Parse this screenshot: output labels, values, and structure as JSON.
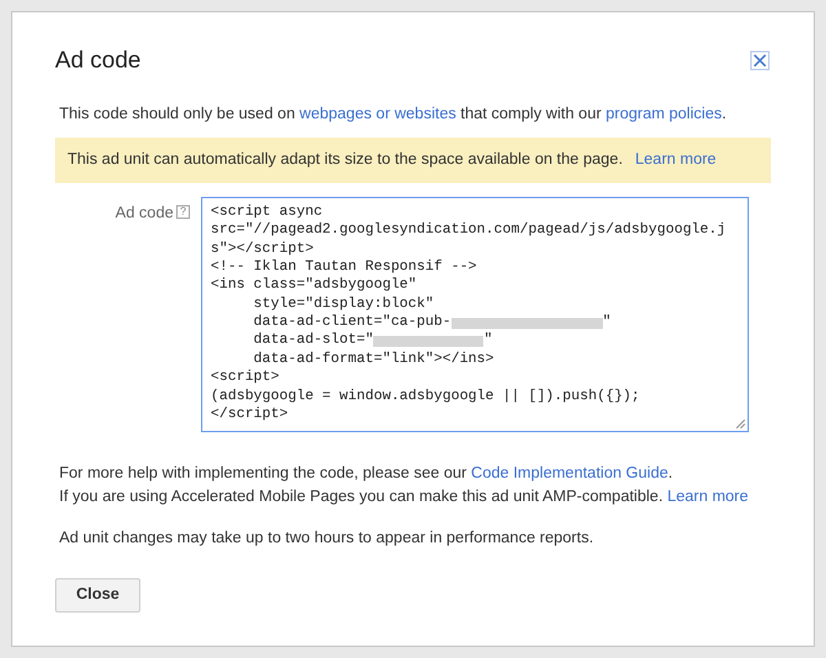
{
  "dialog": {
    "title": "Ad code"
  },
  "notice": {
    "parts": [
      {
        "kind": "text",
        "text": "This code should only be used on "
      },
      {
        "kind": "link",
        "text": "webpages or websites"
      },
      {
        "kind": "text",
        "text": " that comply with our "
      },
      {
        "kind": "link",
        "text": "program policies"
      },
      {
        "kind": "text",
        "text": "."
      }
    ]
  },
  "info_banner": {
    "text": "This ad unit can automatically adapt its size to the space available on the page.",
    "link": "Learn more"
  },
  "ad_code": {
    "label": "Ad code",
    "help": "?",
    "lines": [
      {
        "text": "<script async",
        "redacted": false
      },
      {
        "text": "src=\"//pagead2.googlesyndication.com/pagead/js/adsbygoogle.j",
        "redacted": false
      },
      {
        "text": "s\"></script>",
        "redacted": false
      },
      {
        "text": "<!-- Iklan Tautan Responsif -->",
        "redacted": false
      },
      {
        "text": "<ins class=\"adsbygoogle\"",
        "redacted": false
      },
      {
        "text": "     style=\"display:block\"",
        "redacted": false
      },
      {
        "text": "     data-ad-client=\"ca-pub-",
        "redacted": true,
        "after": "\""
      },
      {
        "text": "     data-ad-slot=\"",
        "redacted": true,
        "after": "\""
      },
      {
        "text": "     data-ad-format=\"link\"></ins>",
        "redacted": false
      },
      {
        "text": "<script>",
        "redacted": false
      },
      {
        "text": "(adsbygoogle = window.adsbygoogle || []).push({});",
        "redacted": false
      },
      {
        "text": "</script>",
        "redacted": false
      }
    ]
  },
  "help_lines": [
    {
      "text": "For more help with implementing the code, please see our ",
      "link": "Code Implementation Guide",
      "after": "."
    },
    {
      "text": "If you are using Accelerated Mobile Pages you can make this ad unit AMP-compatible. ",
      "link": "Learn more"
    }
  ],
  "footer_note": "Ad unit changes may take up to two hours to appear in performance reports.",
  "buttons": [
    "Close"
  ]
}
